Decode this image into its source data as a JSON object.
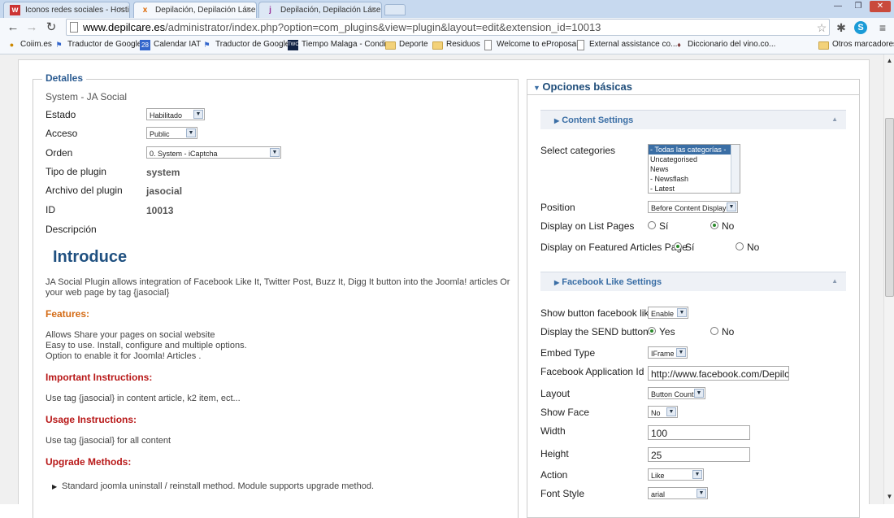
{
  "browser": {
    "tabs": [
      {
        "title": "Iconos redes sociales - Hostin",
        "favicon": "w"
      },
      {
        "title": "Depilación, Depilación Láser, I",
        "favicon": "x"
      },
      {
        "title": "Depilación, Depilación Láser, I",
        "favicon": "j"
      }
    ],
    "url_domain": "www.depilcare.es",
    "url_path": "/administrator/index.php?option=com_plugins&view=plugin&layout=edit&extension_id=10013",
    "bookmarks": [
      "Coiim.es",
      "Traductor de Google",
      "Calendar IAT",
      "Traductor de Google",
      "Tiempo Malaga - Condi...",
      "Deporte",
      "Residuos",
      "Welcome to eProposal.",
      "External assistance co...",
      "Diccionario del vino.co..."
    ],
    "other_bookmarks": "Otros marcadores",
    "calendar_day": "28",
    "twc": "TWC"
  },
  "details": {
    "legend": "Detalles",
    "plugin_name": "System - JA Social",
    "estado_label": "Estado",
    "estado_value": "Habilitado",
    "acceso_label": "Acceso",
    "acceso_value": "Public",
    "orden_label": "Orden",
    "orden_value": "0. System - iCaptcha",
    "tipo_label": "Tipo de plugin",
    "tipo_value": "system",
    "archivo_label": "Archivo del plugin",
    "archivo_value": "jasocial",
    "id_label": "ID",
    "id_value": "10013",
    "desc_label": "Descripción",
    "intro_title": "Introduce",
    "intro_text_1": "JA Social Plugin allows integration of Facebook Like It, Twitter Post, Buzz It, Digg It button into the Joomla! articles Or",
    "intro_text_2": "your web page by tag {jasocial}",
    "features_title": "Features:",
    "features_1": "Allows Share your pages on social website",
    "features_2": "Easy to use. Install, configure and multiple options.",
    "features_3": "Option to enable it for Joomla! Articles .",
    "important_title": "Important Instructions:",
    "important_text": "Use tag {jasocial} in content article, k2 item, ect...",
    "usage_title": "Usage Instructions:",
    "usage_text": "Use tag {jasocial} for all content",
    "upgrade_title": "Upgrade Methods:",
    "upgrade_item": "Standard joomla uninstall / reinstall method. Module supports upgrade method."
  },
  "options": {
    "title": "Opciones básicas",
    "content_settings": "Content Settings",
    "select_categories_label": "Select categories",
    "categories": [
      "- Todas las categorías -",
      "Uncategorised",
      "News",
      "- Newsflash",
      "- Latest"
    ],
    "position_label": "Position",
    "position_value": "Before Content Display",
    "list_pages_label": "Display on List Pages",
    "featured_label": "Display on Featured Articles Page",
    "si": "Sí",
    "no": "No",
    "yes": "Yes",
    "facebook_settings": "Facebook Like Settings",
    "show_fb_label": "Show button facebook like?",
    "show_fb_value": "Enable",
    "send_label": "Display the SEND button",
    "embed_label": "Embed Type",
    "embed_value": "IFrame",
    "app_id_label": "Facebook Application Id",
    "app_id_value": "http://www.facebook.com/DepilcareC",
    "layout_label": "Layout",
    "layout_value": "Button Count",
    "show_face_label": "Show Face",
    "show_face_value": "No",
    "width_label": "Width",
    "width_value": "100",
    "height_label": "Height",
    "height_value": "25",
    "action_label": "Action",
    "action_value": "Like",
    "font_label": "Font Style",
    "font_value": "arial"
  }
}
